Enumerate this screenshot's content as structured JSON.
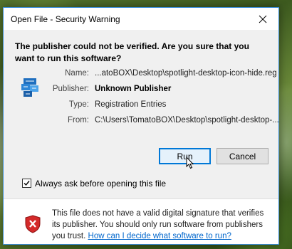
{
  "dialog": {
    "title": "Open File - Security Warning",
    "question": "The publisher could not be verified. Are you sure that you want to run this software?",
    "fields": {
      "name_label": "Name:",
      "name_value": "...atoBOX\\Desktop\\spotlight-desktop-icon-hide.reg",
      "publisher_label": "Publisher:",
      "publisher_value": "Unknown Publisher",
      "type_label": "Type:",
      "type_value": "Registration Entries",
      "from_label": "From:",
      "from_value": "C:\\Users\\TomatoBOX\\Desktop\\spotlight-desktop-..."
    },
    "buttons": {
      "run_label": "Run",
      "cancel_label": "Cancel"
    },
    "checkbox": {
      "label": "Always ask before opening this file",
      "checked": true
    },
    "footer": {
      "message": "This file does not have a valid digital signature that verifies its publisher. You should only run software from publishers you trust.",
      "link_text": "How can I decide what software to run?"
    },
    "icons": {
      "close": "close-icon",
      "file": "registry-file-icon",
      "warning": "security-shield-icon"
    },
    "colors": {
      "accent": "#0078d7",
      "link": "#0066cc",
      "shield_red": "#d42a2a"
    }
  }
}
